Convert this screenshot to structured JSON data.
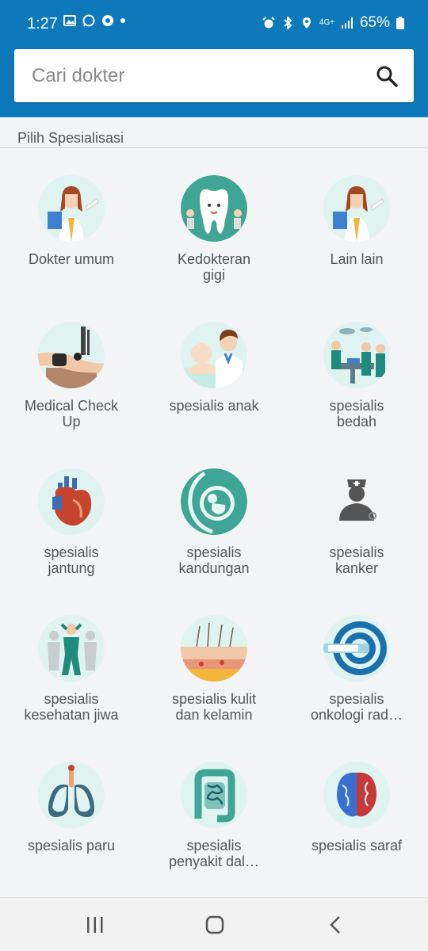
{
  "status_bar": {
    "time": "1:27",
    "network": "4G+",
    "battery": "65%"
  },
  "search": {
    "placeholder": "Cari dokter"
  },
  "section": {
    "title": "Pilih Spesialisasi"
  },
  "specialties": [
    {
      "label": "Dokter umum",
      "icon": "female-doctor-icon"
    },
    {
      "label": "Kedokteran\ngigi",
      "icon": "tooth-icon"
    },
    {
      "label": "Lain lain",
      "icon": "female-doctor-icon"
    },
    {
      "label": "Medical Check\nUp",
      "icon": "blood-pressure-icon"
    },
    {
      "label": "spesialis anak",
      "icon": "pediatric-icon"
    },
    {
      "label": "spesialis\nbedah",
      "icon": "surgery-icon"
    },
    {
      "label": "spesialis\njantung",
      "icon": "heart-icon"
    },
    {
      "label": "spesialis\nkandungan",
      "icon": "fetus-icon"
    },
    {
      "label": "spesialis\nkanker",
      "icon": "oncologist-icon"
    },
    {
      "label": "spesialis\nkesehatan jiwa",
      "icon": "mental-health-icon"
    },
    {
      "label": "spesialis kulit\ndan kelamin",
      "icon": "skin-icon"
    },
    {
      "label": "spesialis\nonkologi rad…",
      "icon": "radiology-scanner-icon"
    },
    {
      "label": "spesialis paru",
      "icon": "lungs-icon"
    },
    {
      "label": "spesialis\npenyakit dal…",
      "icon": "intestine-icon"
    },
    {
      "label": "spesialis saraf",
      "icon": "brain-icon"
    }
  ],
  "colors": {
    "header": "#0d79ba",
    "icon_bg": "#dff3f1"
  }
}
